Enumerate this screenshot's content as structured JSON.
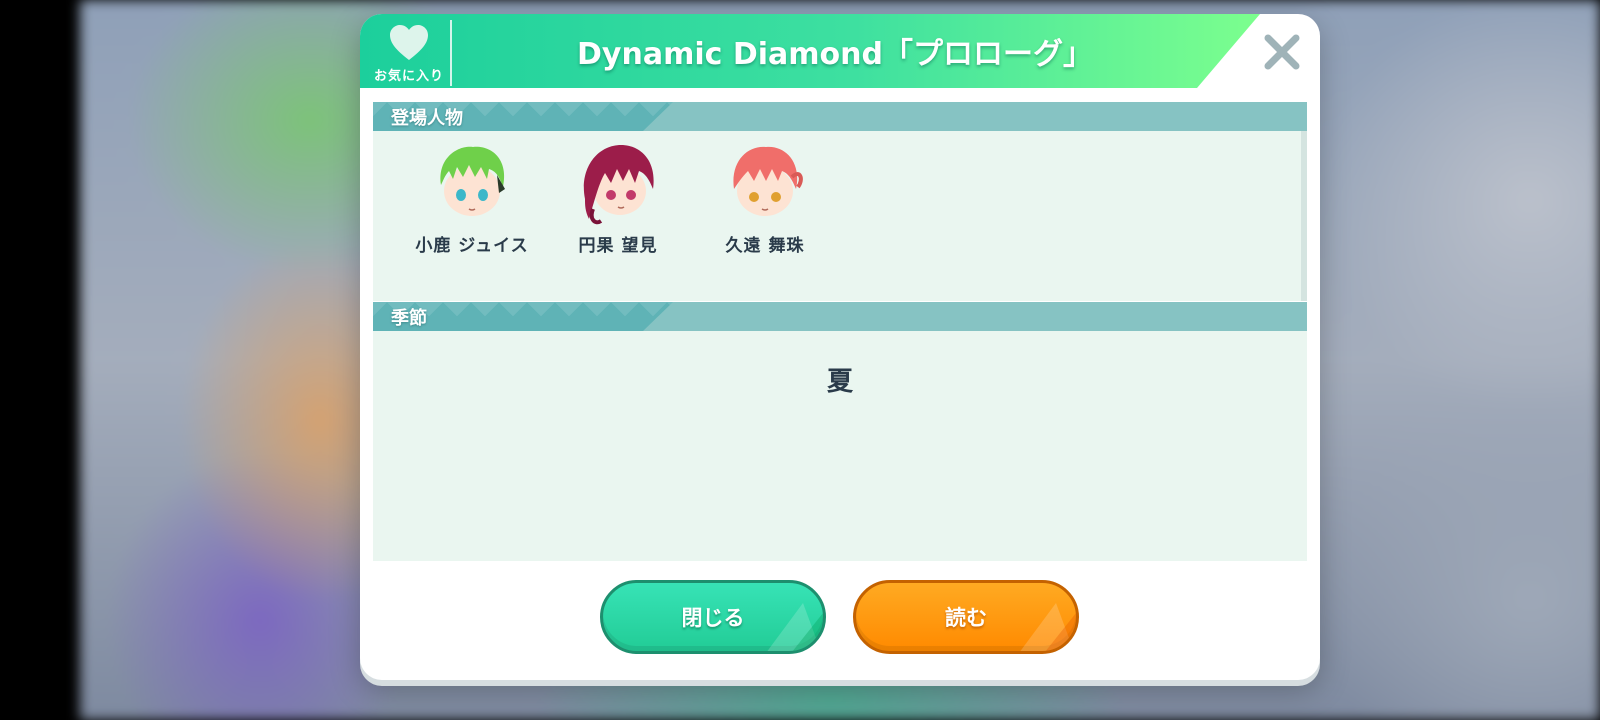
{
  "header": {
    "favorite_label": "お気に入り",
    "title": "Dynamic Diamond「プロローグ」"
  },
  "sections": {
    "characters_label": "登場人物",
    "season_label": "季節"
  },
  "characters": [
    {
      "name": "小鹿 ジュイス",
      "hair_color": "#6fd04a",
      "eye_color": "#3bb7c9"
    },
    {
      "name": "円果 望見",
      "hair_color": "#9c1d4a",
      "eye_color": "#c23a6a"
    },
    {
      "name": "久遠 舞珠",
      "hair_color": "#f06e6a",
      "eye_color": "#e0a030"
    }
  ],
  "season": {
    "value": "夏"
  },
  "buttons": {
    "close_label": "閉じる",
    "read_label": "読む"
  },
  "colors": {
    "header_gradient_start": "#1ccf9c",
    "header_gradient_end": "#7cff8e",
    "section_bar": "#86c3c3",
    "close_button": "#22cc96",
    "read_button": "#ff8a00"
  }
}
